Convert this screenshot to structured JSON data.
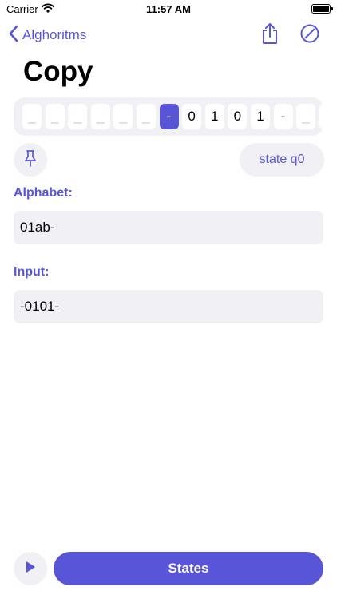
{
  "status_bar": {
    "carrier": "Carrier",
    "time": "11:57 AM"
  },
  "nav": {
    "back_label": "Alghoritms",
    "icons": [
      "chevron-left-icon",
      "share-icon",
      "prohibit-icon"
    ]
  },
  "page": {
    "title": "Copy"
  },
  "tape": {
    "cells": [
      "_",
      "_",
      "_",
      "_",
      "_",
      "_",
      "-",
      "0",
      "1",
      "0",
      "1",
      "-",
      "_",
      "_"
    ],
    "active_index": 6
  },
  "state": {
    "label": "state q0"
  },
  "alphabet": {
    "label": "Alphabet:",
    "value": "01ab-"
  },
  "input": {
    "label": "Input:",
    "value": "-0101-"
  },
  "bottom": {
    "states_label": "States",
    "icons": [
      "pin-icon",
      "play-icon"
    ]
  },
  "colors": {
    "accent": "#5856D6",
    "surface": "#F0F0F5",
    "blank_cell_text": "#C7C7CC"
  }
}
